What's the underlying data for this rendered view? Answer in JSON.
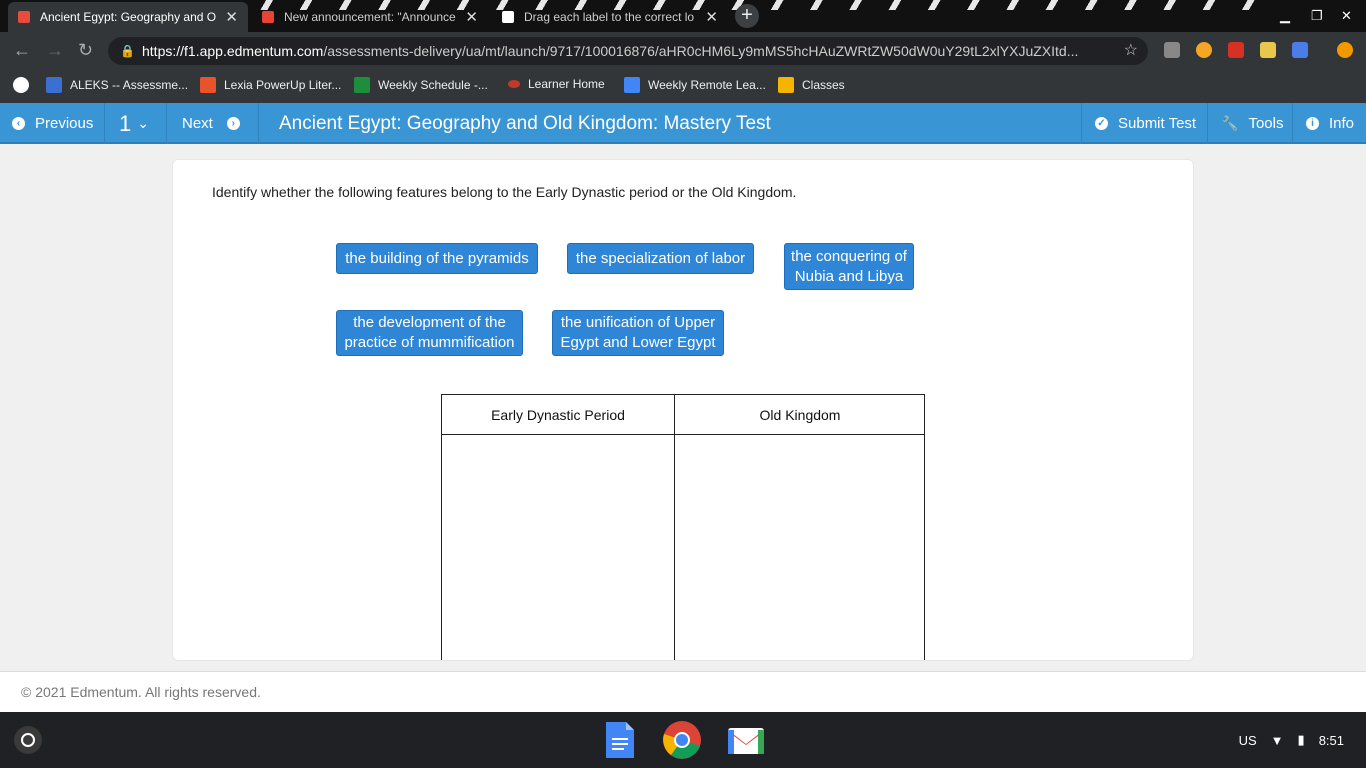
{
  "browser": {
    "tabs": [
      {
        "label": "Ancient Egypt: Geography and O",
        "active": true
      },
      {
        "label": "New announcement: \"Announce",
        "active": false
      },
      {
        "label": "Drag each label to the correct lo",
        "active": false
      }
    ],
    "url_host": "https://f1.app.edmentum.com",
    "url_path": "/assessments-delivery/ua/mt/launch/9717/100016876/aHR0cHM6Ly9mMS5hcHAuZWRtZW50dW0uY29tL2xlYXJuZXItd...",
    "bookmarks": [
      {
        "label": "ALEKS -- Assessme..."
      },
      {
        "label": "Lexia PowerUp Liter..."
      },
      {
        "label": "Weekly Schedule -..."
      },
      {
        "label": "Learner Home"
      },
      {
        "label": "Weekly Remote Lea..."
      },
      {
        "label": "Classes"
      }
    ]
  },
  "appbar": {
    "previous": "Previous",
    "question_number": "1",
    "next": "Next",
    "title": "Ancient Egypt: Geography and Old Kingdom: Mastery Test",
    "submit": "Submit Test",
    "tools": "Tools",
    "info": "Info"
  },
  "question": {
    "prompt": "Identify whether the following features belong to the Early Dynastic period or the Old Kingdom.",
    "labels": [
      "the building of the pyramids",
      "the specialization of labor",
      "the conquering of Nubia and Libya",
      "the development of the practice of mummification",
      "the unification of Upper Egypt and Lower Egypt"
    ],
    "columns": [
      "Early Dynastic Period",
      "Old Kingdom"
    ]
  },
  "footer": {
    "copyright": "© 2021 Edmentum. All rights reserved."
  },
  "shelf": {
    "ime": "US",
    "time": "8:51"
  },
  "colors": {
    "appbar": "#3a95d4",
    "tile": "#2f86d6"
  }
}
